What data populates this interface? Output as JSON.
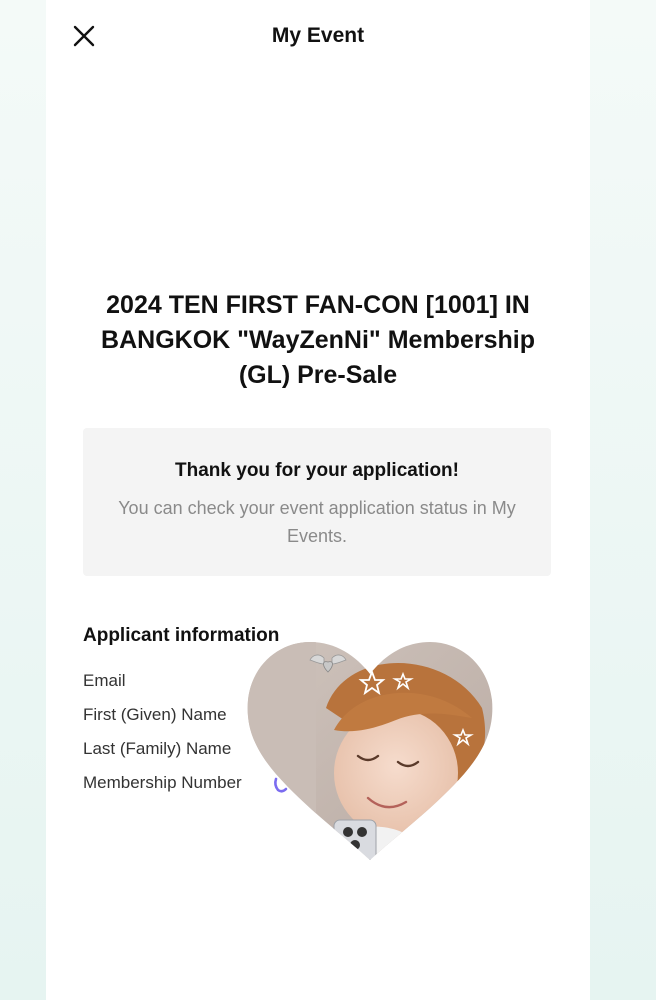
{
  "header": {
    "title": "My Event",
    "close_icon": "close-icon"
  },
  "event": {
    "title_line1": "2024 TEN FIRST FAN-CON [1001] IN",
    "title_line2": "BANGKOK \"WayZenNi\" Membership",
    "title_line3": "(GL) Pre-Sale"
  },
  "notice": {
    "heading": "Thank you for your application!",
    "body": "You can check your event application status in My Events."
  },
  "applicant": {
    "section_title": "Applicant information",
    "fields": [
      "Email",
      "First (Given) Name",
      "Last (Family) Name",
      "Membership Number"
    ]
  },
  "sticker": {
    "shape": "heart",
    "content": "photo of a smiling person with reddish-brown hair, star doodles",
    "stars": [
      "star-icon",
      "star-icon",
      "star-icon"
    ],
    "charm_icon": "winged-heart-icon"
  },
  "colors": {
    "background": "#eaf6f3",
    "sheet": "#ffffff",
    "notice_bg": "#f4f4f4",
    "text_primary": "#111111",
    "text_secondary": "#8a8a8a"
  }
}
